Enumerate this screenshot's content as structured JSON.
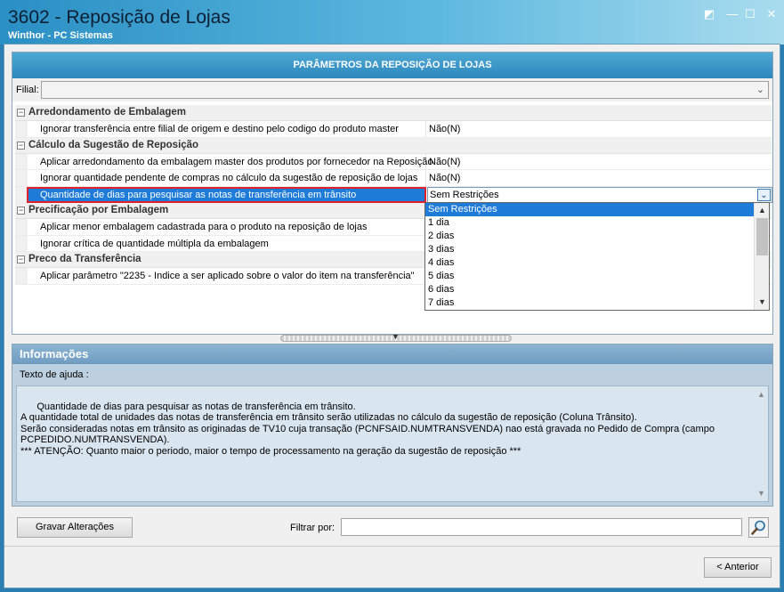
{
  "window": {
    "title": "3602 - Reposição de Lojas",
    "subtitle": "Winthor - PC Sistemas",
    "controls": {
      "restore": "◩",
      "minimize": "—",
      "maximize": "☐",
      "close": "✕"
    }
  },
  "params_panel": {
    "header": "PARÂMETROS DA REPOSIÇÃO DE LOJAS",
    "filial_label": "Filial:",
    "filial_value": "",
    "categories": [
      {
        "label": "Arredondamento de Embalagem",
        "items": [
          {
            "name": "Ignorar transferência entre filial de origem e destino pelo codigo do produto master",
            "value": "Não(N)"
          }
        ]
      },
      {
        "label": "Cálculo da Sugestão de Reposição",
        "items": [
          {
            "name": "Aplicar arredondamento da embalagem master dos produtos por fornecedor na Reposição",
            "value": "Não(N)"
          },
          {
            "name": "Ignorar quantidade pendente de compras no cálculo da sugestão de reposição de lojas",
            "value": "Não(N)"
          },
          {
            "name": "Quantidade de dias para pesquisar as notas de transferência em trânsito",
            "value": "Sem Restrições"
          }
        ]
      },
      {
        "label": "Precificação por Embalagem",
        "items": [
          {
            "name": "Aplicar menor embalagem cadastrada para o produto na reposição de lojas",
            "value": ""
          },
          {
            "name": "Ignorar crítica de quantidade múltipla da embalagem",
            "value": ""
          }
        ]
      },
      {
        "label": "Preco da Transferência",
        "items": [
          {
            "name": "Aplicar parâmetro \"2235 - Indice a ser aplicado sobre o valor do item na transferência\"",
            "value": ""
          }
        ]
      }
    ],
    "dropdown_options": [
      "Sem Restrições",
      "1 dia",
      "2 dias",
      "3 dias",
      "4 dias",
      "5 dias",
      "6 dias",
      "7 dias"
    ],
    "dropdown_selected": "Sem Restrições"
  },
  "info_panel": {
    "header": "Informações",
    "help_label": "Texto de ajuda :",
    "help_text": "Quantidade de dias para pesquisar as notas de transferência em trânsito.\nA quantidade total de unidades das notas de transferência em trânsito serão utilizadas no cálculo da sugestão de reposição (Coluna Trânsito).\nSerão consideradas notas em trânsito as originadas de TV10 cuja transação (PCNFSAID.NUMTRANSVENDA) nao está gravada no Pedido de Compra (campo\nPCPEDIDO.NUMTRANSVENDA).\n*** ATENÇÃO: Quanto maior o periodo, maior o tempo de processamento na geração da sugestão de reposição ***"
  },
  "footer": {
    "save_label": "Gravar Alterações",
    "filter_label": "Filtrar por:",
    "filter_value": "",
    "back_label": "< Anterior"
  }
}
